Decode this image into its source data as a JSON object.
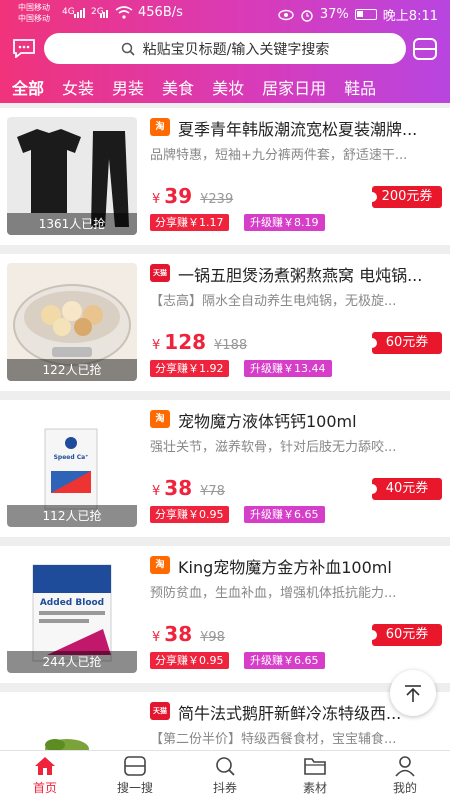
{
  "statusbar": {
    "carrier1": "中国移动",
    "carrier2": "中国移动",
    "net1": "4G",
    "net2": "2G",
    "speed": "456B/s",
    "battery": "37%",
    "time": "晚上8:11"
  },
  "search": {
    "placeholder": "粘贴宝贝标题/输入关键字搜索"
  },
  "categories": [
    "全部",
    "女装",
    "男装",
    "美食",
    "美妆",
    "居家日用",
    "鞋品"
  ],
  "products": [
    {
      "badge": "淘",
      "title": "夏季青年韩版潮流宽松夏装潮牌...",
      "desc": "品牌特惠，短袖+九分裤两件套，舒适速干...",
      "price": "39",
      "old_price": "¥239",
      "coupon": "200元券",
      "share": "分享赚￥1.17",
      "upgrade": "升级赚￥8.19",
      "grabbed": "1361人已抢"
    },
    {
      "badge": "天猫",
      "title": "一锅五胆煲汤煮粥熬燕窝 电炖锅...",
      "desc": "【志高】隔水全自动养生电炖锅，无极旋...",
      "price": "128",
      "old_price": "¥188",
      "coupon": "60元券",
      "share": "分享赚￥1.92",
      "upgrade": "升级赚￥13.44",
      "grabbed": "122人已抢"
    },
    {
      "badge": "淘",
      "title": "宠物魔方液体钙钙100ml",
      "desc": "强壮关节，滋养软骨，针对后肢无力舔咬...",
      "price": "38",
      "old_price": "¥78",
      "coupon": "40元券",
      "share": "分享赚￥0.95",
      "upgrade": "升级赚￥6.65",
      "grabbed": "112人已抢"
    },
    {
      "badge": "淘",
      "title": "King宠物魔方金方补血100ml",
      "desc": "预防贫血，生血补血，增强机体抵抗能力...",
      "price": "38",
      "old_price": "¥98",
      "coupon": "60元券",
      "share": "分享赚￥0.95",
      "upgrade": "升级赚￥6.65",
      "grabbed": "244人已抢"
    },
    {
      "badge": "天猫",
      "title": "简牛法式鹅肝新鲜冷冻特级西...",
      "desc": "【第二份半价】特级西餐食材，宝宝辅食...",
      "price": "",
      "old_price": "",
      "coupon": "",
      "share": "",
      "upgrade": "",
      "grabbed": ""
    }
  ],
  "product_labels": {
    "calcium": "Speed Ca⁺",
    "blood": "Added Blood"
  },
  "tabs": [
    {
      "label": "首页",
      "icon": "home-icon"
    },
    {
      "label": "搜一搜",
      "icon": "scan-search-icon"
    },
    {
      "label": "抖券",
      "icon": "douyin-coupon-icon"
    },
    {
      "label": "素材",
      "icon": "folder-icon"
    },
    {
      "label": "我的",
      "icon": "user-icon"
    }
  ],
  "colors": {
    "accent": "#f0233d",
    "gradient_start": "#f0337a",
    "gradient_end": "#b845e0",
    "upgrade": "#d63dc8"
  }
}
